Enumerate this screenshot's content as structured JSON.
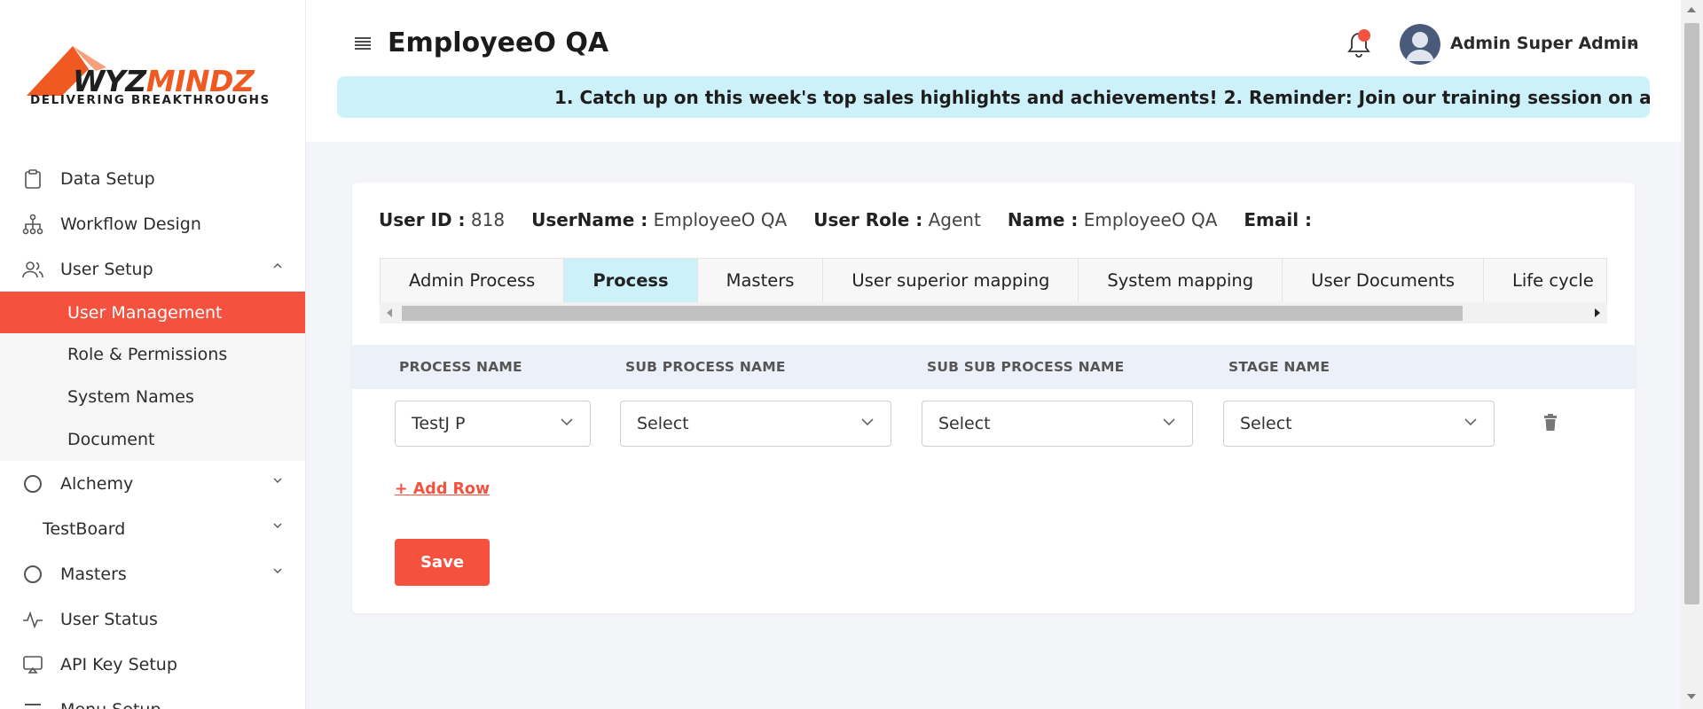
{
  "brand": {
    "word_dark": "WYZ",
    "word_accent": "MINDZ",
    "tagline": "DELIVERING  BREAKTHROUGHS"
  },
  "sidebar": {
    "items": [
      {
        "label": "Data Setup",
        "icon": "clipboard-icon"
      },
      {
        "label": "Workflow Design",
        "icon": "workflow-icon"
      },
      {
        "label": "User Setup",
        "icon": "users-icon",
        "expanded": true,
        "children": [
          {
            "label": "User Management",
            "active": true
          },
          {
            "label": "Role & Permissions"
          },
          {
            "label": "System Names"
          },
          {
            "label": "Document"
          }
        ]
      },
      {
        "label": "Alchemy",
        "icon": "circle-icon"
      },
      {
        "label": "TestBoard"
      },
      {
        "label": "Masters",
        "icon": "circle-icon"
      },
      {
        "label": "User Status",
        "icon": "activity-icon"
      },
      {
        "label": "API Key Setup",
        "icon": "screen-icon"
      },
      {
        "label": "Menu Setup",
        "icon": "menu-icon"
      }
    ]
  },
  "header": {
    "title": "EmployeeO QA",
    "user_name": "Admin Super Admin",
    "ticker": "1. Catch up on this week's top sales highlights and achievements! 2. Reminder: Join our training session on advanced CRM"
  },
  "user_info": {
    "user_id_label": "User ID :",
    "user_id": "818",
    "username_label": "UserName :",
    "username": "EmployeeO QA",
    "role_label": "User Role :",
    "role": "Agent",
    "name_label": "Name :",
    "name": "EmployeeO QA",
    "email_label": "Email :",
    "email": ""
  },
  "tabs": [
    {
      "label": "Admin Process",
      "active": false
    },
    {
      "label": "Process",
      "active": true
    },
    {
      "label": "Masters",
      "active": false
    },
    {
      "label": "User superior mapping",
      "active": false
    },
    {
      "label": "System mapping",
      "active": false
    },
    {
      "label": "User Documents",
      "active": false
    },
    {
      "label": "Life cycle",
      "active": false
    }
  ],
  "table": {
    "headers": [
      "PROCESS NAME",
      "SUB PROCESS NAME",
      "SUB SUB PROCESS NAME",
      "STAGE NAME"
    ],
    "row": {
      "process": "TestJ P",
      "sub_process": "Select",
      "sub_sub_process": "Select",
      "stage": "Select"
    }
  },
  "actions": {
    "add_row": "+ Add Row",
    "save": "Save"
  },
  "colors": {
    "accent": "#f5513f",
    "ticker_bg": "#cdf1f9",
    "active_tab_bg": "#cdf1f9",
    "brand_orange": "#f05a22"
  }
}
